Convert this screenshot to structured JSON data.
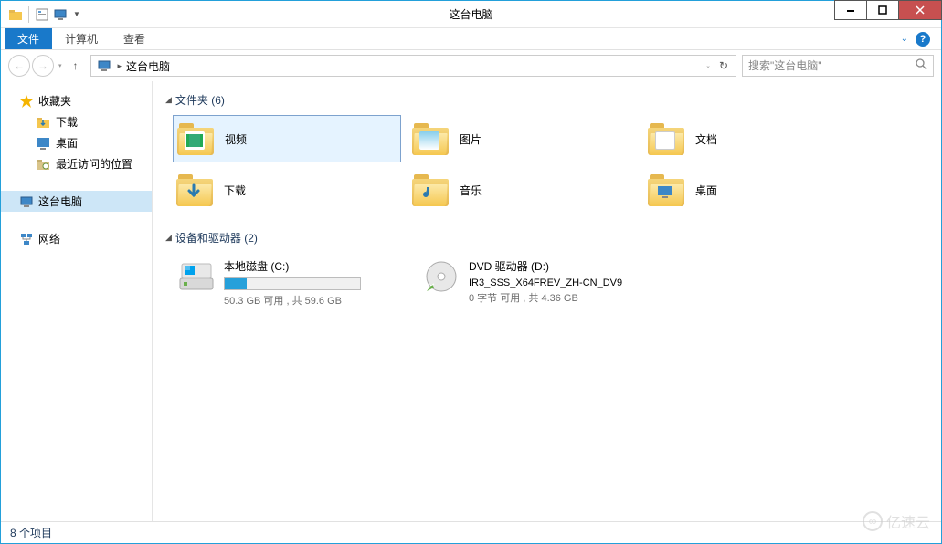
{
  "window": {
    "title": "这台电脑"
  },
  "ribbon": {
    "file": "文件",
    "computer": "计算机",
    "view": "查看"
  },
  "address": {
    "location": "这台电脑",
    "search_placeholder": "搜索\"这台电脑\""
  },
  "sidebar": {
    "favorites": {
      "label": "收藏夹",
      "items": [
        {
          "label": "下载",
          "icon": "download"
        },
        {
          "label": "桌面",
          "icon": "desktop"
        },
        {
          "label": "最近访问的位置",
          "icon": "recent"
        }
      ]
    },
    "this_pc": {
      "label": "这台电脑"
    },
    "network": {
      "label": "网络"
    }
  },
  "sections": {
    "folders": {
      "heading": "文件夹 (6)",
      "items": [
        {
          "label": "视频",
          "icon": "video",
          "selected": true
        },
        {
          "label": "图片",
          "icon": "pictures"
        },
        {
          "label": "文档",
          "icon": "documents"
        },
        {
          "label": "下载",
          "icon": "downloads"
        },
        {
          "label": "音乐",
          "icon": "music"
        },
        {
          "label": "桌面",
          "icon": "desktop"
        }
      ]
    },
    "drives": {
      "heading": "设备和驱动器 (2)",
      "items": [
        {
          "name": "本地磁盘 (C:)",
          "type": "hdd",
          "free_text": "50.3 GB 可用 , 共 59.6 GB",
          "fill_pct": 16
        },
        {
          "name": "DVD 驱动器 (D:)",
          "type": "dvd",
          "subtitle": "IR3_SSS_X64FREV_ZH-CN_DV9",
          "free_text": "0 字节 可用 , 共 4.36 GB"
        }
      ]
    }
  },
  "statusbar": {
    "text": "8 个项目"
  },
  "watermark": "亿速云"
}
